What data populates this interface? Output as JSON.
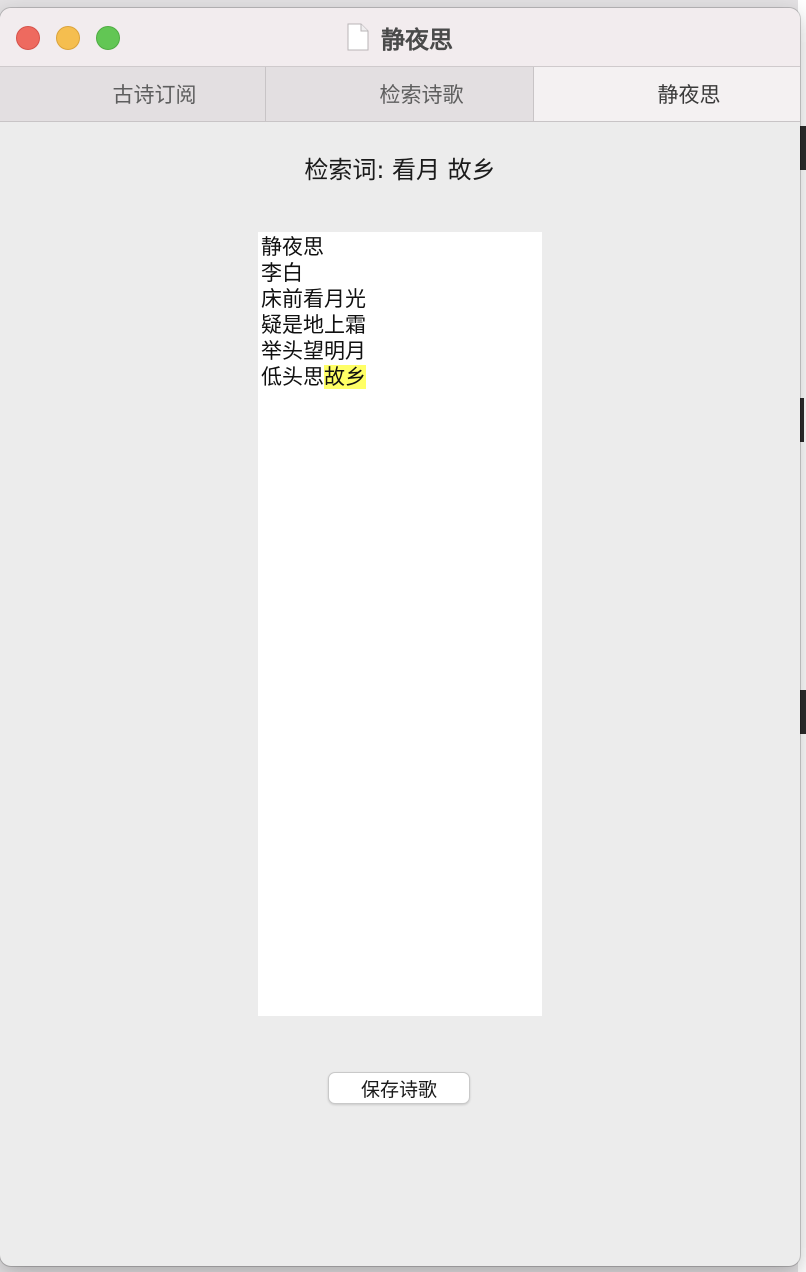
{
  "window": {
    "title": "静夜思",
    "title_icon": "document-icon"
  },
  "tabs": [
    {
      "label": "古诗订阅",
      "selected": false
    },
    {
      "label": "检索诗歌",
      "selected": false
    },
    {
      "label": "静夜思",
      "selected": true
    }
  ],
  "search": {
    "label": "检索词: 看月 故乡"
  },
  "poem": {
    "lines": [
      {
        "text": "静夜思"
      },
      {
        "text": "李白"
      },
      {
        "text": "床前看月光"
      },
      {
        "text": "疑是地上霜"
      },
      {
        "text": "举头望明月"
      },
      {
        "text": "低头思",
        "highlight": "故乡"
      }
    ],
    "highlight_color": "#ffff66"
  },
  "actions": {
    "save_label": "保存诗歌"
  },
  "colors": {
    "close": "#ee6a5f",
    "minimize": "#f5be4f",
    "maximize": "#62c654"
  }
}
